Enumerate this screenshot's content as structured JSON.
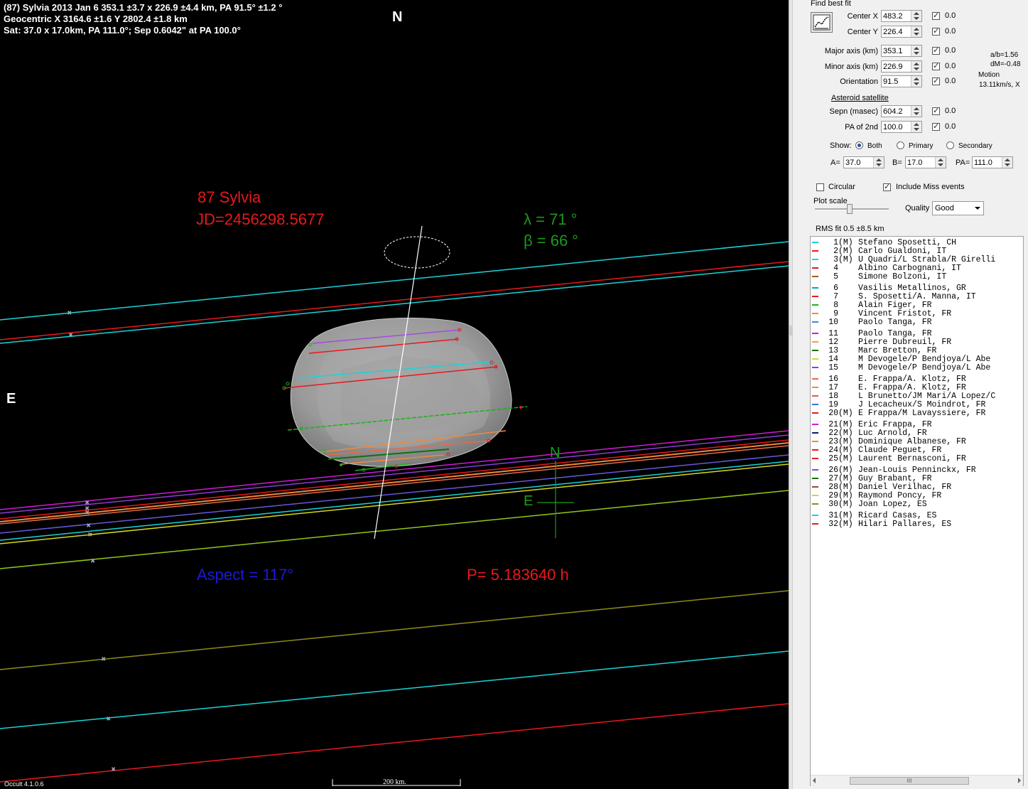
{
  "header": {
    "line1": "(87) Sylvia  2013 Jan 6   353.1 ±3.7 x 226.9 ±4.4 km,  PA 91.5° ±1.2 °",
    "line2": "Geocentric  X  3164.6 ±1.6  Y 2802.4 ±1.8 km",
    "line3": "Sat: 37.0 x 17.0km,  PA 111.0°; Sep 0.6042\" at PA 100.0°"
  },
  "plot": {
    "north_label": "N",
    "east_label": "E",
    "asteroid_name": "87 Sylvia",
    "jd": "JD=2456298.5677",
    "lambda": "λ =   71 °",
    "beta": "β =   66 °",
    "aspect": "Aspect = 117°",
    "period": "P= 5.183640 h",
    "compass_n": "N",
    "compass_e": "E",
    "scale_label": "200 km.",
    "version": "Occult 4.1.0.6"
  },
  "panel": {
    "find_best_fit": "Find best fit",
    "center_x_label": "Center X",
    "center_x": "483.2",
    "center_x_dev": "0.0",
    "center_y_label": "Center Y",
    "center_y": "226.4",
    "center_y_dev": "0.0",
    "major_label": "Major axis (km)",
    "major": "353.1",
    "major_dev": "0.0",
    "minor_label": "Minor axis (km)",
    "minor": "226.9",
    "minor_dev": "0.0",
    "orient_label": "Orientation",
    "orient": "91.5",
    "orient_dev": "0.0",
    "ab_ratio": "a/b=1.56",
    "dm": "dM=-0.48",
    "motion_label": "Motion",
    "motion": "13.11km/s, X",
    "sat_heading": "Asteroid satellite",
    "sepn_label": "Sepn (masec)",
    "sepn": "604.2",
    "sepn_dev": "0.0",
    "pa2_label": "PA of 2nd",
    "pa2": "100.0",
    "pa2_dev": "0.0",
    "show_label": "Show:",
    "show_both": "Both",
    "show_primary": "Primary",
    "show_secondary": "Secondary",
    "a_label": "A=",
    "a_val": "37.0",
    "b_label": "B=",
    "b_val": "17.0",
    "pa_label": "PA=",
    "pa_val": "111.0",
    "circular": "Circular",
    "include_miss": "Include Miss events",
    "plot_scale": "Plot scale",
    "quality_label": "Quality",
    "quality": "Good",
    "rms": "RMS fit 0.5 ±8.5 km",
    "scroll_thumb_glyph": "III"
  },
  "colors": {
    "cyan": "#19d3d8",
    "red": "#e8181c",
    "green": "#18b418",
    "orange": "#f08a3c",
    "magenta": "#d21ad2",
    "purple": "#8a3cd8",
    "blue": "#3c6ee6",
    "yellow": "#d8d81a",
    "olive": "#8c8c1a",
    "dkgreen": "#107010",
    "navy": "#141478",
    "violet": "#6a56d8"
  },
  "observers": [
    {
      "num": "1",
      "flag": "(M)",
      "name": "Stefano Sposetti, CH",
      "color": "#19d3d8"
    },
    {
      "num": "2",
      "flag": "(M)",
      "name": "Carlo Gualdoni, IT",
      "color": "#e8181c"
    },
    {
      "num": "3",
      "flag": "(M)",
      "name": "U Quadri/L Strabla/R Girelli",
      "color": "#19d3d8"
    },
    {
      "num": "4",
      "flag": "",
      "name": "Albino Carbognani, IT",
      "color": "#e8181c"
    },
    {
      "num": "5",
      "flag": "",
      "name": "Simone Bolzoni, IT",
      "color": "#a05a1a"
    },
    {
      "num": "6",
      "flag": "",
      "name": "Vasilis Metallinos, GR",
      "color": "#19a0a0"
    },
    {
      "num": "7",
      "flag": "",
      "name": "S. Sposetti/A. Manna, IT",
      "color": "#e8181c"
    },
    {
      "num": "8",
      "flag": "",
      "name": "Alain Figer, FR",
      "color": "#18b418"
    },
    {
      "num": "9",
      "flag": "",
      "name": "Vincent Fristot, FR",
      "color": "#f08a3c"
    },
    {
      "num": "10",
      "flag": "",
      "name": "Paolo Tanga, FR",
      "color": "#3c8ae6"
    },
    {
      "num": "11",
      "flag": "",
      "name": "Paolo Tanga, FR",
      "color": "#d21ad2"
    },
    {
      "num": "12",
      "flag": "",
      "name": "Pierre Dubreuil, FR",
      "color": "#f0a030"
    },
    {
      "num": "13",
      "flag": "",
      "name": "Marc Bretton, FR",
      "color": "#107010"
    },
    {
      "num": "14",
      "flag": "",
      "name": "M Devogele/P Bendjoya/L Abe",
      "color": "#d8d81a"
    },
    {
      "num": "15",
      "flag": "",
      "name": "M Devogele/P Bendjoya/L Abe",
      "color": "#8a3cd8"
    },
    {
      "num": "16",
      "flag": "",
      "name": "E. Frappa/A. Klotz, FR",
      "color": "#e86a4a"
    },
    {
      "num": "17",
      "flag": "",
      "name": "E. Frappa/A. Klotz, FR",
      "color": "#f08a3c"
    },
    {
      "num": "18",
      "flag": "",
      "name": "L Brunetto/JM Mari/A Lopez/C",
      "color": "#e85a30"
    },
    {
      "num": "19",
      "flag": "",
      "name": "J Lecacheux/S Moindrot, FR",
      "color": "#3c6ee6"
    },
    {
      "num": "20",
      "flag": "(M)",
      "name": "E Frappa/M Lavayssiere, FR",
      "color": "#e8181c"
    },
    {
      "num": "21",
      "flag": "(M)",
      "name": "Eric Frappa, FR",
      "color": "#d21ad2"
    },
    {
      "num": "22",
      "flag": "(M)",
      "name": "Luc Arnold, FR",
      "color": "#141478"
    },
    {
      "num": "23",
      "flag": "(M)",
      "name": "Dominique Albanese, FR",
      "color": "#f08a3c"
    },
    {
      "num": "24",
      "flag": "(M)",
      "name": "Claude Peguet, FR",
      "color": "#e8181c"
    },
    {
      "num": "25",
      "flag": "(M)",
      "name": "Laurent Bernasconi, FR",
      "color": "#e8181c"
    },
    {
      "num": "26",
      "flag": "(M)",
      "name": "Jean-Louis Penninckx, FR",
      "color": "#6a56d8"
    },
    {
      "num": "27",
      "flag": "(M)",
      "name": "Guy Brabant, FR",
      "color": "#107010"
    },
    {
      "num": "28",
      "flag": "(M)",
      "name": "Daniel Verilhac, FR",
      "color": "#8a5030"
    },
    {
      "num": "29",
      "flag": "(M)",
      "name": "Raymond Poncy, FR",
      "color": "#d8d81a"
    },
    {
      "num": "30",
      "flag": "(M)",
      "name": "Joan Lopez, ES",
      "color": "#8c8c1a"
    },
    {
      "num": "31",
      "flag": "(M)",
      "name": "Ricard Casas, ES",
      "color": "#19d3d8"
    },
    {
      "num": "32",
      "flag": "(M)",
      "name": "Hilari Pallares, ES",
      "color": "#e8181c"
    }
  ]
}
